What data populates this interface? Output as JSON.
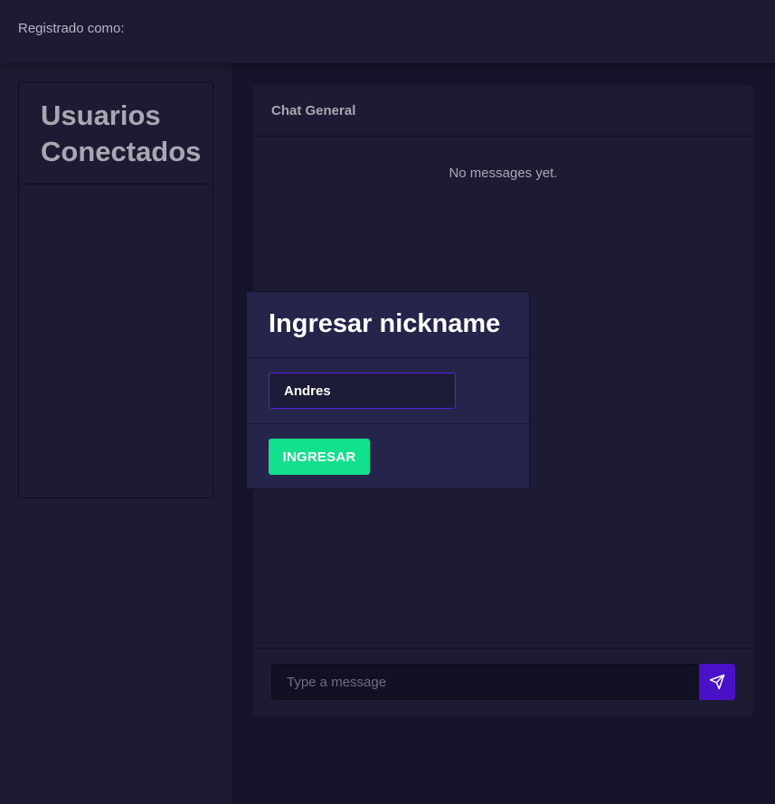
{
  "header": {
    "registered_label": "Registrado como:"
  },
  "sidebar": {
    "title": "Usuarios Conectados",
    "users": []
  },
  "chat": {
    "title": "Chat General",
    "empty_text": "No messages yet.",
    "message_input": {
      "value": "",
      "placeholder": "Type a message"
    },
    "send_icon": "send-icon"
  },
  "modal": {
    "title": "Ingresar nickname",
    "nickname_input": {
      "value": "Andres"
    },
    "submit_label": "INGRESAR"
  },
  "colors": {
    "background": "#15142a",
    "panel": "#1c1b33",
    "modal": "#25244a",
    "accent_purple": "#4a12c8",
    "accent_green": "#12e08d",
    "text_muted": "#a9a8b2"
  }
}
